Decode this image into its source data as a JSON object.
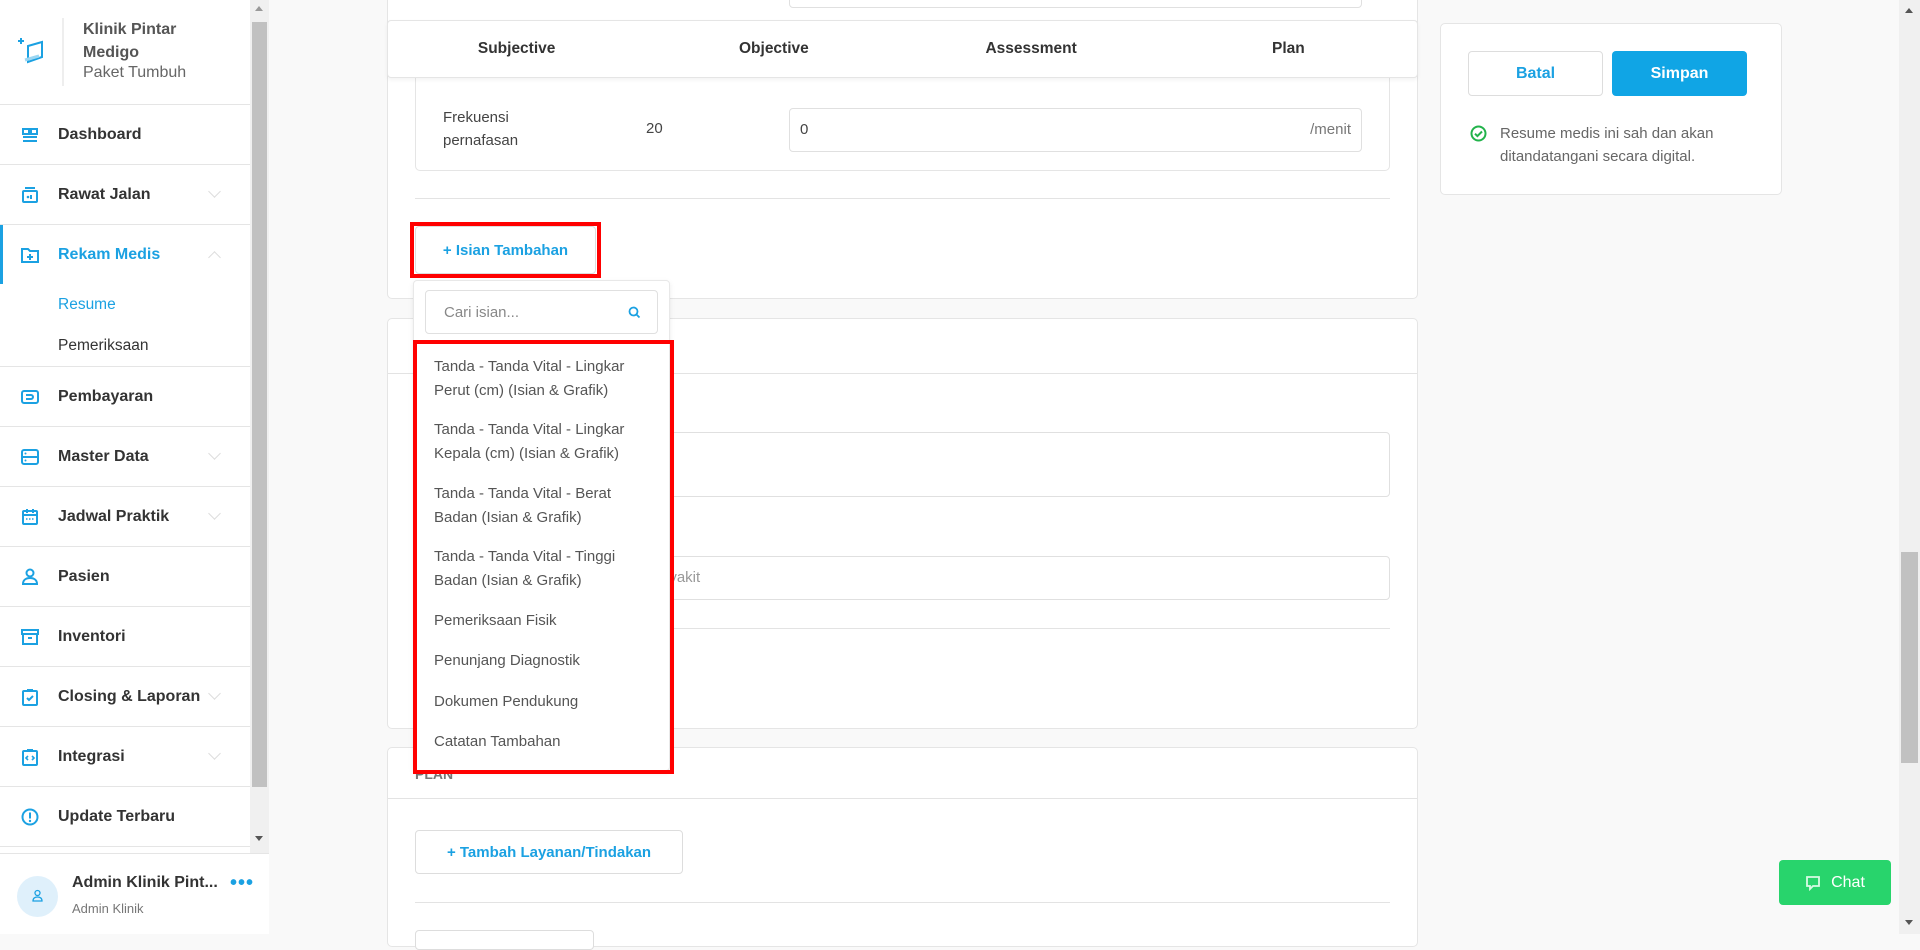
{
  "brand": {
    "name_line1": "Klinik Pintar",
    "name_line2": "Medigo",
    "package": "Paket Tumbuh"
  },
  "sidebar": {
    "items": [
      {
        "label": "Dashboard",
        "icon": "dashboard-icon"
      },
      {
        "label": "Rawat Jalan",
        "icon": "outpatient-icon",
        "chevron": "down"
      },
      {
        "label": "Rekam Medis",
        "icon": "folder-plus-icon",
        "chevron": "up",
        "active": true,
        "sub": [
          {
            "label": "Resume",
            "active": true
          },
          {
            "label": "Pemeriksaan"
          }
        ]
      },
      {
        "label": "Pembayaran",
        "icon": "payment-icon"
      },
      {
        "label": "Master Data",
        "icon": "server-icon",
        "chevron": "down"
      },
      {
        "label": "Jadwal Praktik",
        "icon": "calendar-icon",
        "chevron": "down"
      },
      {
        "label": "Pasien",
        "icon": "user-icon"
      },
      {
        "label": "Inventori",
        "icon": "archive-icon"
      },
      {
        "label": "Closing & Laporan",
        "icon": "clipboard-check-icon",
        "chevron": "down"
      },
      {
        "label": "Integrasi",
        "icon": "code-icon",
        "chevron": "down"
      },
      {
        "label": "Update Terbaru",
        "icon": "alert-circle-icon"
      }
    ]
  },
  "user": {
    "name": "Admin Klinik Pint...",
    "role": "Admin Klinik"
  },
  "tabs": [
    "Subjective",
    "Objective",
    "Assessment",
    "Plan"
  ],
  "vitals_row": {
    "label_line1": "Frekuensi",
    "label_line2": "pernafasan",
    "normal": "20",
    "value": "0",
    "unit": "/menit"
  },
  "isian_button": "+ Isian Tambahan",
  "dropdown": {
    "search_placeholder": "Cari isian...",
    "items": [
      [
        "Tanda - Tanda Vital - Lingkar",
        "Perut (cm) (Isian & Grafik)"
      ],
      [
        "Tanda - Tanda Vital - Lingkar",
        "Kepala (cm) (Isian & Grafik)"
      ],
      [
        "Tanda - Tanda Vital - Berat",
        "Badan (Isian & Grafik)"
      ],
      [
        "Tanda - Tanda Vital - Tinggi",
        "Badan (Isian & Grafik)"
      ],
      [
        "Pemeriksaan Fisik"
      ],
      [
        "Penunjang Diagnostik"
      ],
      [
        "Dokumen Pendukung"
      ],
      [
        "Catatan Tambahan"
      ]
    ]
  },
  "assessment": {
    "diagnosis_placeholder_visible": "nyakit"
  },
  "plan": {
    "section_label": "PLAN",
    "add_button": "+ Tambah Layanan/Tindakan"
  },
  "actions": {
    "cancel": "Batal",
    "save": "Simpan",
    "note": "Resume medis ini sah dan akan ditandatangani secara digital."
  },
  "chat": {
    "label": "Chat"
  },
  "colors": {
    "accent": "#12a4e6",
    "highlight": "#ff0000",
    "chat": "#28d46c",
    "success": "#22b34b"
  }
}
